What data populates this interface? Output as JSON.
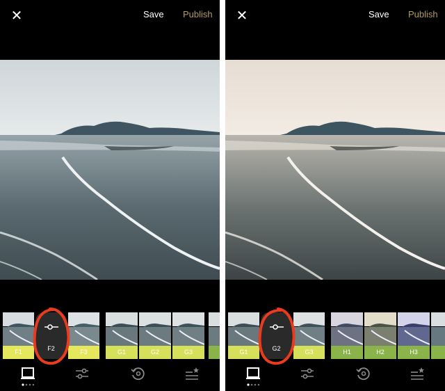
{
  "colors": {
    "publish": "#b49a61",
    "annotation": "#e93b1f",
    "lime": "#e5e85c",
    "green": "#8ab44a"
  },
  "left": {
    "save_label": "Save",
    "publish_label": "Publish",
    "filters": [
      {
        "label": "F1"
      },
      {
        "label": "F2",
        "selected": true
      },
      {
        "label": "F3"
      },
      {
        "label": "G1"
      },
      {
        "label": "G2"
      },
      {
        "label": "G3"
      },
      {
        "label": ""
      }
    ]
  },
  "right": {
    "save_label": "Save",
    "publish_label": "Publish",
    "filters": [
      {
        "label": "G1"
      },
      {
        "label": "G2",
        "selected": true
      },
      {
        "label": "G3"
      },
      {
        "label": "H1"
      },
      {
        "label": "H2"
      },
      {
        "label": "H3"
      },
      {
        "label": ""
      }
    ]
  },
  "icons": {
    "close": "close-icon",
    "adjust": "slider-adjust-icon",
    "filters_tab": "image-frame-icon",
    "tools": "sliders-icon",
    "history": "history-icon",
    "presets": "presets-star-icon"
  }
}
